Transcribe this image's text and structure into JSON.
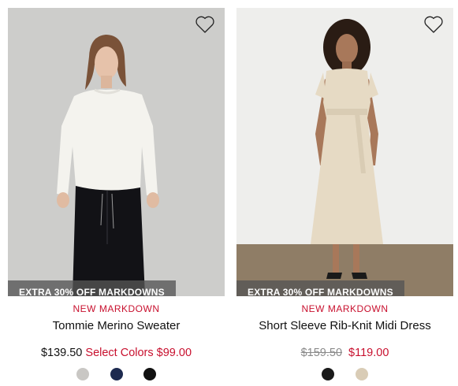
{
  "products": [
    {
      "badge": "EXTRA 30% OFF MARKDOWNS",
      "tag": "NEW MARKDOWN",
      "name": "Tommie Merino Sweater",
      "price_regular": "$139.50",
      "price_select_label": "Select Colors",
      "price_sale": "$99.00",
      "swatches": [
        "#c9c7c4",
        "#1d2a4f",
        "#111111"
      ],
      "favorite_icon": "heart-outline-icon"
    },
    {
      "badge": "EXTRA 30% OFF MARKDOWNS",
      "tag": "NEW MARKDOWN",
      "name": "Short Sleeve Rib-Knit Midi Dress",
      "price_original": "$159.50",
      "price_sale": "$119.00",
      "swatches": [
        "#1a1a1a",
        "#d9ccb6"
      ],
      "favorite_icon": "heart-outline-icon"
    }
  ],
  "colors": {
    "accent_red": "#c8102e",
    "badge_bg": "#555555"
  }
}
